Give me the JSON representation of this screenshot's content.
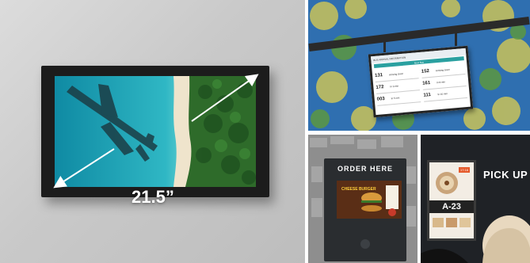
{
  "main": {
    "size_label": "21.5”"
  },
  "bus_stop": {
    "header": "BUS ARRIVAL INFORMATION",
    "tab": "Next Bus",
    "rows": [
      {
        "num": "131",
        "dest": "Arriving Soon"
      },
      {
        "num": "172",
        "dest": "In 3 min"
      },
      {
        "num": "003",
        "dest": "In 5 min"
      }
    ],
    "rows_right": [
      {
        "num": "152",
        "dest": "Arriving Soon"
      },
      {
        "num": "161",
        "dest": "In 8 min"
      },
      {
        "num": "111",
        "dest": "In 10 min"
      }
    ]
  },
  "drive_thru": {
    "title": "ORDER HERE",
    "promo": "CHEESE BURGER"
  },
  "pickup": {
    "label": "PICK UP",
    "order_number": "A-23",
    "badge": "17:16"
  },
  "colors": {
    "sea": "#1a9bb0",
    "forest": "#2e6b2a",
    "bezel": "#1c1c1c",
    "bus_accent": "#2aa0a0",
    "burger_yellow": "#ffcf3a"
  }
}
